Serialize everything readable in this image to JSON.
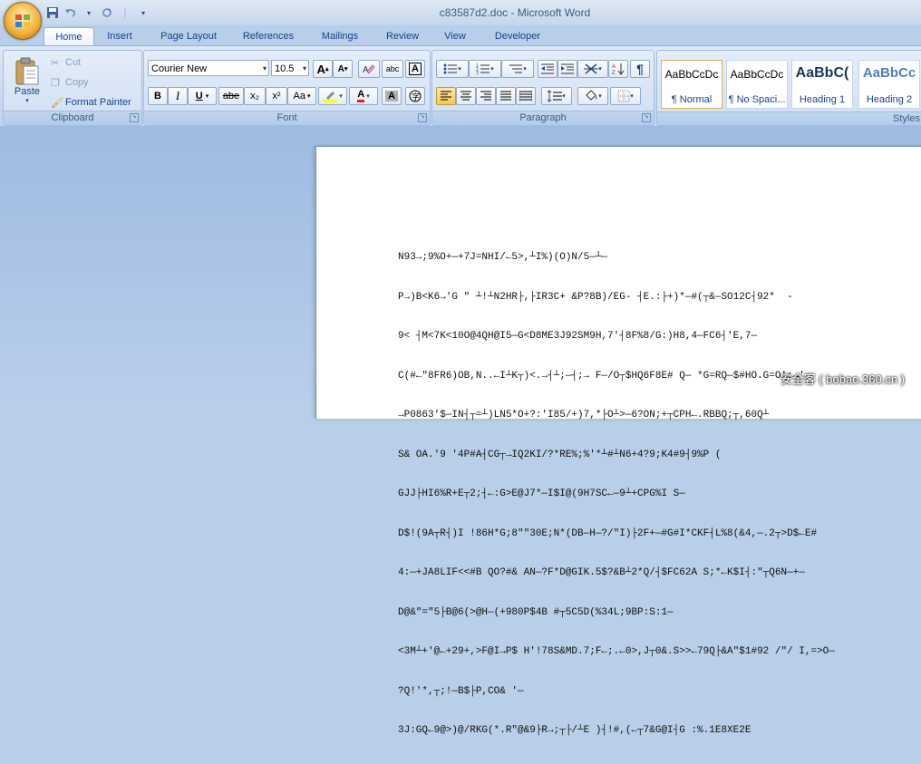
{
  "window": {
    "title": "c83587d2.doc - Microsoft Word"
  },
  "quick_access": {
    "save_icon": "save-icon",
    "undo_icon": "undo-icon",
    "redo_icon": "redo-icon"
  },
  "tabs": [
    "Home",
    "Insert",
    "Page Layout",
    "References",
    "Mailings",
    "Review",
    "View",
    "Developer"
  ],
  "clipboard": {
    "paste": "Paste",
    "cut": "Cut",
    "copy": "Copy",
    "format_painter": "Format Painter",
    "group_label": "Clipboard"
  },
  "font": {
    "family": "Courier New",
    "size": "10.5",
    "grow": "A",
    "shrink": "A",
    "bold": "B",
    "italic": "I",
    "underline": "U",
    "strike": "abe",
    "subscript": "x₂",
    "superscript": "x²",
    "change_case": "Aa",
    "font_color_letter": "A",
    "shade_letter": "A",
    "group_label": "Font"
  },
  "paragraph": {
    "group_label": "Paragraph",
    "pilcrow": "¶"
  },
  "styles": {
    "group_label": "Styles",
    "items": [
      {
        "sample": "AaBbCcDc",
        "name": "¶ Normal"
      },
      {
        "sample": "AaBbCcDc",
        "name": "¶ No Spaci..."
      },
      {
        "sample": "AaBbC(",
        "name": "Heading 1"
      },
      {
        "sample": "AaBbCc",
        "name": "Heading 2"
      }
    ]
  },
  "document": {
    "lines": [
      "N93→;9%O+—+7J=NHI/←5>,┴I%)(O)N/5—┴—",
      "P→)B<K6→'G \" ┴!┴N2HR├,├IR3C+ &P?8B)/EG- ┤E.:├+)*—#(┬&—SO12C┤92*  -",
      "9< ┤M<7K<10O@4QH@I5—G<D8ME3J92SM9H,7'┤8F%8/G:)H8,4—FC6┤'E,7—",
      "C(#←\"8FR6)OB,N..←I┴K┬)<.→┤┴;—┤;→ F—/O┬$HQ6F8E# Q— *G=RQ—$#HO.G=O':→'",
      "→P0863'$—IN┤┬=┴)LN5*O+?:'I85/+)7,*├O┴>—6?ON;+┬CPH←.RBBQ;┬,60Q┴",
      "S& OA.'9 '4P#A┤CG┬→IQ2KI/?*RE%;%'*┴#┴N6+4?9;K4#9┤9%P (",
      "GJJ├HI6%R+E┬2;┤←:G>E@J7*—I$I@(9H7SC←—9┴+CPG%I S—",
      "D$!(9A┬R┤)I !86H*G;8\"\"30E;N*(DB—H—?/\"I)├2F+—#G#I*CKF┤L%8(&4,—.2┬>D$←E#",
      "4:—+JA8LIF<<#B QO?#& AN—?F*D@GIK.5$?&B┴2*Q/┤$FC62A S;*←K$I┤:\"┬Q6N—+—",
      "D@&\"=\"5├B@6(>@H—(+980P$4B #┬5C5D(%34L;9BP:S:1—",
      "<3M┴+'@←+29+,>F@I→P$ H'!78S&MD.7;F←;.←0>,J┬0&.S>>←79Q├&A\"$1#92 /\"/ I,=>O—",
      "?Q!'*,┬;!—B$├P,CO& '—",
      "3J:GQ←9@>)@/RKG(*.R\"@&9├R→;┬├/┴E )┤!#,(←┬7&G@I┤G :%.1E8XE2E"
    ]
  },
  "watermark": {
    "text": "安全客 ( bobao.360.cn )"
  }
}
